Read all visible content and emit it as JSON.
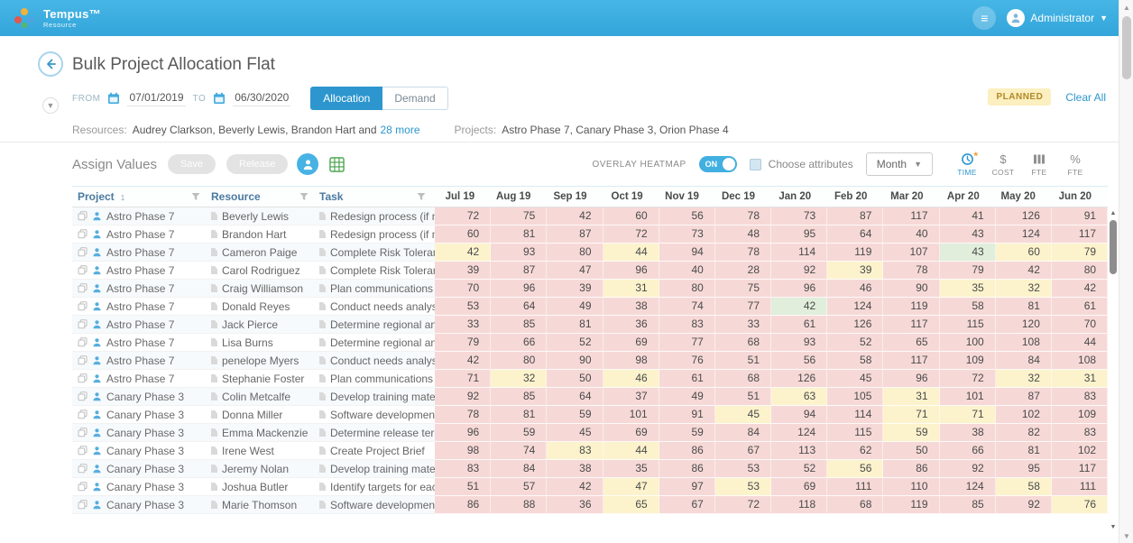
{
  "header": {
    "brand": "Tempus™",
    "brand_sub": "Resource",
    "user": "Administrator"
  },
  "page": {
    "title": "Bulk Project Allocation Flat",
    "from_label": "FROM",
    "from_value": "07/01/2019",
    "to_label": "TO",
    "to_value": "06/30/2020",
    "mode_allocation": "Allocation",
    "mode_demand": "Demand",
    "planned_badge": "PLANNED",
    "clear_all": "Clear All"
  },
  "context": {
    "resources_label": "Resources:",
    "resources_value": "Audrey Clarkson, Beverly Lewis, Brandon Hart and",
    "resources_more": "28 more",
    "projects_label": "Projects:",
    "projects_value": "Astro Phase 7, Canary Phase 3, Orion Phase 4"
  },
  "toolbar": {
    "assign_values": "Assign Values",
    "save": "Save",
    "release": "Release",
    "overlay_heatmap": "OVERLAY HEATMAP",
    "toggle_state": "ON",
    "choose_attributes": "Choose attributes",
    "period": "Month",
    "tabs": [
      {
        "id": "time",
        "label": "TIME",
        "icon": "clock-icon",
        "active": true,
        "badge": "*"
      },
      {
        "id": "cost",
        "label": "COST",
        "icon": "dollar-icon",
        "active": false
      },
      {
        "id": "fte",
        "label": "FTE",
        "icon": "bars-icon",
        "active": false
      },
      {
        "id": "pct-fte",
        "label": "FTE",
        "icon": "percent-icon",
        "active": false
      }
    ]
  },
  "table": {
    "columns": [
      "Project",
      "Resource",
      "Task"
    ],
    "sort_indicator": "1",
    "months": [
      "Jul 19",
      "Aug 19",
      "Sep 19",
      "Oct 19",
      "Nov 19",
      "Dec 19",
      "Jan 20",
      "Feb 20",
      "Mar 20",
      "Apr 20",
      "May 20",
      "Jun 20"
    ],
    "rows": [
      {
        "project": "Astro Phase 7",
        "resource": "Beverly Lewis",
        "task": "Redesign process (if necessary)",
        "values": [
          72,
          75,
          42,
          60,
          56,
          78,
          73,
          87,
          117,
          41,
          126,
          91
        ],
        "colors": [
          "r",
          "r",
          "r",
          "r",
          "r",
          "r",
          "r",
          "r",
          "r",
          "r",
          "r",
          "r"
        ]
      },
      {
        "project": "Astro Phase 7",
        "resource": "Brandon Hart",
        "task": "Redesign process (if necessary)",
        "values": [
          60,
          81,
          87,
          72,
          73,
          48,
          95,
          64,
          40,
          43,
          124,
          117
        ],
        "colors": [
          "r",
          "r",
          "r",
          "r",
          "r",
          "r",
          "r",
          "r",
          "r",
          "r",
          "r",
          "r"
        ]
      },
      {
        "project": "Astro Phase 7",
        "resource": "Cameron Paige",
        "task": "Complete Risk Tolerance Asse...",
        "values": [
          42,
          93,
          80,
          44,
          94,
          78,
          114,
          119,
          107,
          43,
          60,
          79
        ],
        "colors": [
          "y",
          "r",
          "r",
          "y",
          "r",
          "r",
          "r",
          "r",
          "r",
          "g",
          "y",
          "y"
        ]
      },
      {
        "project": "Astro Phase 7",
        "resource": "Carol Rodriguez",
        "task": "Complete Risk Tolerance Asse...",
        "values": [
          39,
          87,
          47,
          96,
          40,
          28,
          92,
          39,
          78,
          79,
          42,
          80
        ],
        "colors": [
          "r",
          "r",
          "r",
          "r",
          "r",
          "r",
          "r",
          "y",
          "r",
          "r",
          "r",
          "r"
        ]
      },
      {
        "project": "Astro Phase 7",
        "resource": "Craig Williamson",
        "task": "Plan communications method...",
        "values": [
          70,
          96,
          39,
          31,
          80,
          75,
          96,
          46,
          90,
          35,
          32,
          42
        ],
        "colors": [
          "r",
          "r",
          "r",
          "y",
          "r",
          "r",
          "r",
          "r",
          "r",
          "y",
          "y",
          "r"
        ]
      },
      {
        "project": "Astro Phase 7",
        "resource": "Donald Reyes",
        "task": "Conduct needs analysis",
        "values": [
          53,
          64,
          49,
          38,
          74,
          77,
          42,
          124,
          119,
          58,
          81,
          61
        ],
        "colors": [
          "r",
          "r",
          "r",
          "r",
          "r",
          "r",
          "g",
          "r",
          "r",
          "r",
          "r",
          "r"
        ]
      },
      {
        "project": "Astro Phase 7",
        "resource": "Jack Pierce",
        "task": "Determine regional and count...",
        "values": [
          33,
          85,
          81,
          36,
          83,
          33,
          61,
          126,
          117,
          115,
          120,
          70
        ],
        "colors": [
          "r",
          "r",
          "r",
          "r",
          "r",
          "r",
          "r",
          "r",
          "r",
          "r",
          "r",
          "r"
        ]
      },
      {
        "project": "Astro Phase 7",
        "resource": "Lisa Burns",
        "task": "Determine regional and count...",
        "values": [
          79,
          66,
          52,
          69,
          77,
          68,
          93,
          52,
          65,
          100,
          108,
          44
        ],
        "colors": [
          "r",
          "r",
          "r",
          "r",
          "r",
          "r",
          "r",
          "r",
          "r",
          "r",
          "r",
          "r"
        ]
      },
      {
        "project": "Astro Phase 7",
        "resource": "penelope Myers",
        "task": "Conduct needs analysis",
        "values": [
          42,
          80,
          90,
          98,
          76,
          51,
          56,
          58,
          117,
          109,
          84,
          108
        ],
        "colors": [
          "r",
          "r",
          "r",
          "r",
          "r",
          "r",
          "r",
          "r",
          "r",
          "r",
          "r",
          "r"
        ]
      },
      {
        "project": "Astro Phase 7",
        "resource": "Stephanie Foster",
        "task": "Plan communications method...",
        "values": [
          71,
          32,
          50,
          46,
          61,
          68,
          126,
          45,
          96,
          72,
          32,
          31
        ],
        "colors": [
          "r",
          "y",
          "r",
          "y",
          "r",
          "r",
          "r",
          "r",
          "r",
          "r",
          "y",
          "y"
        ]
      },
      {
        "project": "Canary Phase 3",
        "resource": "Colin Metcalfe",
        "task": "Develop training materials",
        "values": [
          92,
          85,
          64,
          37,
          49,
          51,
          63,
          105,
          31,
          101,
          87,
          83
        ],
        "colors": [
          "r",
          "r",
          "r",
          "r",
          "r",
          "r",
          "y",
          "r",
          "y",
          "r",
          "r",
          "r"
        ]
      },
      {
        "project": "Canary Phase 3",
        "resource": "Donna Miller",
        "task": "Software development templa...",
        "values": [
          78,
          81,
          59,
          101,
          91,
          45,
          94,
          114,
          71,
          71,
          102,
          109
        ],
        "colors": [
          "r",
          "r",
          "r",
          "r",
          "r",
          "y",
          "r",
          "r",
          "y",
          "y",
          "r",
          "r"
        ]
      },
      {
        "project": "Canary Phase 3",
        "resource": "Emma Mackenzie",
        "task": "Determine release terms",
        "values": [
          96,
          59,
          45,
          69,
          59,
          84,
          124,
          115,
          59,
          38,
          82,
          83
        ],
        "colors": [
          "r",
          "r",
          "r",
          "r",
          "r",
          "r",
          "r",
          "r",
          "y",
          "r",
          "r",
          "r"
        ]
      },
      {
        "project": "Canary Phase 3",
        "resource": "Irene West",
        "task": "Create Project Brief",
        "values": [
          98,
          74,
          83,
          44,
          86,
          67,
          113,
          62,
          50,
          66,
          81,
          102
        ],
        "colors": [
          "r",
          "r",
          "y",
          "y",
          "r",
          "r",
          "r",
          "r",
          "r",
          "r",
          "r",
          "r"
        ]
      },
      {
        "project": "Canary Phase 3",
        "resource": "Jeremy Nolan",
        "task": "Develop training materials",
        "values": [
          83,
          84,
          38,
          35,
          86,
          53,
          52,
          56,
          86,
          92,
          95,
          117
        ],
        "colors": [
          "r",
          "r",
          "r",
          "r",
          "r",
          "r",
          "r",
          "y",
          "r",
          "r",
          "r",
          "r"
        ]
      },
      {
        "project": "Canary Phase 3",
        "resource": "Joshua Butler",
        "task": "Identify targets for each camp...",
        "values": [
          51,
          57,
          42,
          47,
          97,
          53,
          69,
          111,
          110,
          124,
          58,
          111
        ],
        "colors": [
          "r",
          "r",
          "r",
          "y",
          "r",
          "y",
          "r",
          "r",
          "r",
          "r",
          "y",
          "r"
        ]
      },
      {
        "project": "Canary Phase 3",
        "resource": "Marie Thomson",
        "task": "Software development templa...",
        "values": [
          86,
          88,
          36,
          65,
          67,
          72,
          118,
          68,
          119,
          85,
          92,
          76
        ],
        "colors": [
          "r",
          "r",
          "r",
          "y",
          "r",
          "r",
          "r",
          "r",
          "r",
          "r",
          "r",
          "y"
        ]
      }
    ]
  }
}
